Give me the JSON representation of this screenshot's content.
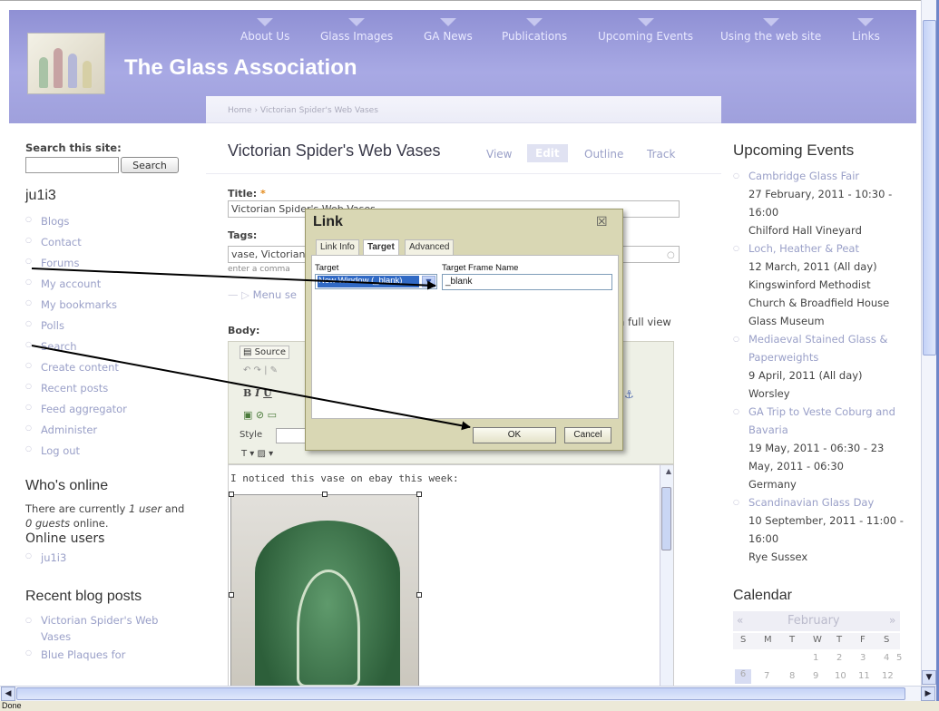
{
  "header": {
    "site_name": "The Glass Association",
    "nav": [
      "About Us",
      "Glass Images",
      "GA News",
      "Publications",
      "Upcoming Events",
      "Using the web site",
      "Links"
    ]
  },
  "breadcrumb": "Home › Victorian Spider's Web Vases",
  "page": {
    "title": "Victorian Spider's Web Vases",
    "tabs": [
      "View",
      "Edit",
      "Outline",
      "Track"
    ],
    "active_tab": "Edit"
  },
  "form": {
    "title_label": "Title:",
    "required_mark": "*",
    "title_value": "Victorian Spider's Web Vases",
    "tags_label": "Tags:",
    "tags_value": "vase, Victorian",
    "tags_hint": "enter a comma",
    "menu_settings": "Menu se",
    "body_label": "Body:",
    "full_view_text": "n full view",
    "source_button": "Source",
    "style_label": "Style",
    "body_text": "I noticed this vase on ebay this week:"
  },
  "left_sidebar": {
    "search_heading": "Search this site:",
    "search_button": "Search",
    "search_value": "",
    "user_heading": "ju1i3",
    "nav": [
      "Blogs",
      "Contact",
      "Forums",
      "My account",
      "My bookmarks",
      "Polls",
      "Search",
      "Create content",
      "Recent posts",
      "Feed aggregator",
      "Administer",
      "Log out"
    ],
    "whos_online_heading": "Who's online",
    "online_text_pre": "There are currently ",
    "online_users_count": "1 user",
    "online_text_mid": " and ",
    "online_guests_count": "0 guests",
    "online_text_post": " online.",
    "online_users_heading": "Online users",
    "online_users": [
      "ju1i3"
    ],
    "recent_blog_heading": "Recent blog posts",
    "recent_posts": [
      "Victorian Spider's Web Vases",
      "Blue Plaques for"
    ]
  },
  "right_sidebar": {
    "events_heading": "Upcoming Events",
    "events": [
      {
        "title": "Cambridge Glass Fair",
        "info": [
          "27 February, 2011 - 10:30 - 16:00",
          "Chilford Hall Vineyard"
        ]
      },
      {
        "title": "Loch, Heather & Peat",
        "info": [
          "12 March, 2011 (All day)",
          "Kingswinford Methodist Church & Broadfield House Glass Museum"
        ]
      },
      {
        "title": "Mediaeval Stained Glass & Paperweights",
        "info": [
          "9 April, 2011 (All day)",
          "Worsley"
        ]
      },
      {
        "title": "GA Trip to Veste Coburg and Bavaria",
        "info": [
          "19 May, 2011 - 06:30 - 23 May, 2011 - 06:30",
          "Germany"
        ]
      },
      {
        "title": "Scandinavian Glass Day",
        "info": [
          "10 September, 2011 - 11:00 - 16:00",
          "Rye Sussex"
        ]
      }
    ],
    "calendar_heading": "Calendar",
    "calendar_prev": "«",
    "calendar_month": "February",
    "calendar_next": "»",
    "calendar_days": [
      "S",
      "M",
      "T",
      "W",
      "T",
      "F",
      "S"
    ],
    "calendar_row1": [
      "1",
      "2",
      "3",
      "4",
      "5"
    ],
    "calendar_row2": [
      "6",
      "7",
      "8",
      "9",
      "10",
      "11",
      "12"
    ]
  },
  "dialog": {
    "title": "Link",
    "close": "☒",
    "tabs": [
      "Link Info",
      "Target",
      "Advanced"
    ],
    "active_tab": "Target",
    "target_label": "Target",
    "target_value": "New Window (_blank)",
    "frame_label": "Target Frame Name",
    "frame_value": "_blank",
    "ok": "OK",
    "cancel": "Cancel"
  },
  "status_bar": "Done"
}
